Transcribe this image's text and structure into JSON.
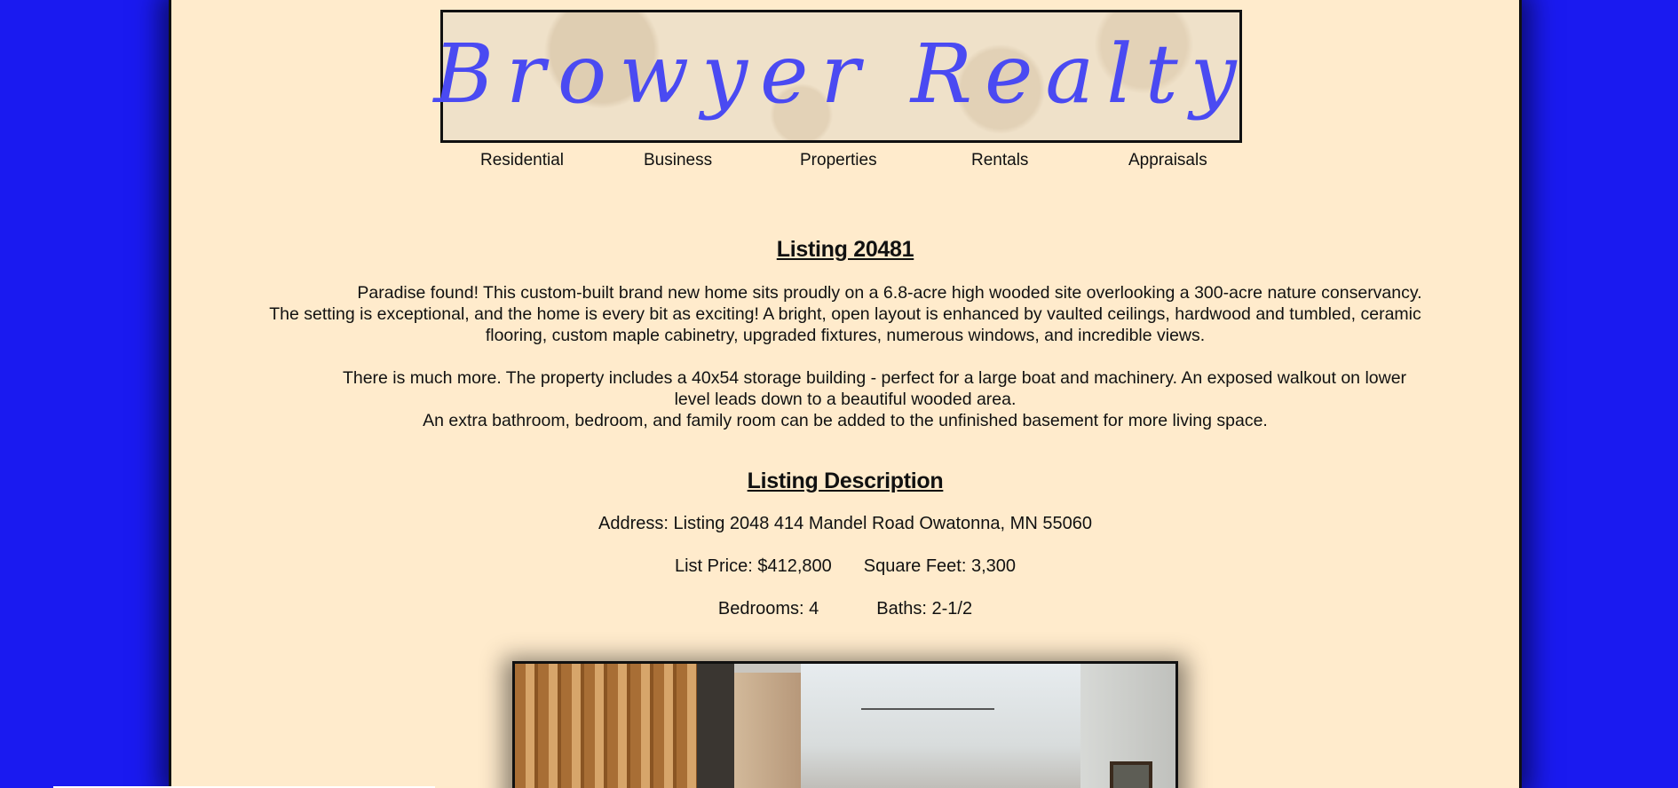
{
  "site": {
    "banner_title": "Browyer Realty"
  },
  "nav": {
    "items": [
      {
        "label": "Residential"
      },
      {
        "label": "Business"
      },
      {
        "label": "Properties"
      },
      {
        "label": "Rentals"
      },
      {
        "label": "Appraisals"
      }
    ]
  },
  "listing": {
    "heading": "Listing 20481",
    "paragraph1": "Paradise found! This custom-built brand new home sits proudly on a 6.8-acre high wooded site overlooking a 300-acre nature conservancy. The setting is exceptional, and the home is every bit as exciting! A bright, open layout is enhanced by vaulted ceilings, hardwood and tumbled, ceramic flooring, custom maple cabinetry, upgraded fixtures, numerous windows, and incredible views.",
    "paragraph2_line1": "There is much more. The property includes a 40x54 storage building - perfect for a large boat and machinery. An exposed walkout on lower level leads down to a beautiful wooded area.",
    "paragraph2_line2": "An extra bathroom, bedroom, and family room can be added to the unfinished basement for more living space."
  },
  "description": {
    "heading": "Listing Description",
    "address": "Address: Listing 2048 414 Mandel Road Owatonna, MN 55060",
    "list_price": "List Price: $412,800",
    "square_feet": "Square Feet: 3,300",
    "bedrooms": "Bedrooms: 4",
    "baths": "Baths: 2-1/2"
  },
  "colors": {
    "background": "#1a1af0",
    "page": "#ffebcc",
    "banner_text": "#4a4af2"
  }
}
